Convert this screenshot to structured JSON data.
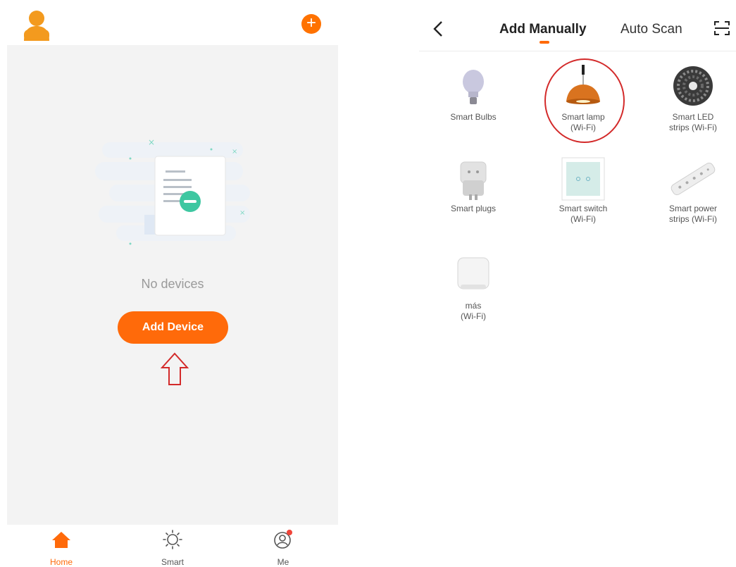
{
  "home": {
    "empty_text": "No devices",
    "add_device_label": "Add Device",
    "tabs": [
      {
        "label": "Home",
        "icon": "home-icon"
      },
      {
        "label": "Smart",
        "icon": "sun-icon"
      },
      {
        "label": "Me",
        "icon": "profile-icon"
      }
    ]
  },
  "add_manually": {
    "tabs": [
      {
        "label": "Add Manually"
      },
      {
        "label": "Auto Scan"
      }
    ],
    "devices": [
      {
        "line1": "Smart Bulbs",
        "line2": ""
      },
      {
        "line1": "Smart lamp",
        "line2": "(Wi-Fi)"
      },
      {
        "line1": "Smart LED",
        "line2": "strips (Wi-Fi)"
      },
      {
        "line1": "Smart plugs",
        "line2": ""
      },
      {
        "line1": "Smart switch",
        "line2": "(Wi-Fi)"
      },
      {
        "line1": "Smart power",
        "line2": "strips (Wi-Fi)"
      },
      {
        "line1": "más",
        "line2": "(Wi-Fi)"
      }
    ]
  },
  "colors": {
    "accent": "#ff6a0a",
    "highlight": "#d32a2a",
    "badge": "#f0453a"
  }
}
